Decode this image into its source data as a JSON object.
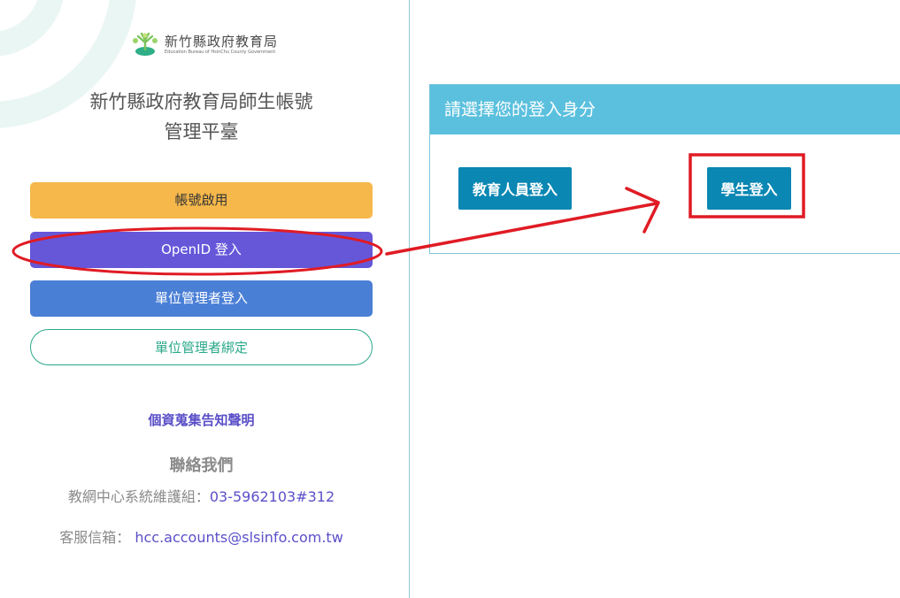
{
  "logo": {
    "text": "新竹縣政府教育局",
    "subtitle": "Education Bureau of HsinChu County Government"
  },
  "sidebar": {
    "title_line1": "新竹縣政府教育局師生帳號",
    "title_line2": "管理平臺",
    "buttons": {
      "activate": "帳號啟用",
      "openid": "OpenID 登入",
      "admin_login": "單位管理者登入",
      "admin_bind": "單位管理者綁定"
    },
    "privacy_link": "個資蒐集告知聲明",
    "contact": {
      "title": "聯絡我們",
      "phone_label": "教網中心系統維護組：",
      "phone": "03-5962103#312",
      "email_label": "客服信箱：",
      "email": "hcc.accounts@slsinfo.com.tw"
    }
  },
  "panel": {
    "header": "請選擇您的登入身分",
    "staff_button": "教育人員登入",
    "student_button": "學生登入"
  },
  "colors": {
    "activate": "#f6b84b",
    "openid": "#6657d9",
    "admin": "#4a7fd6",
    "bind": "#2aa889",
    "panel_header": "#5bc0de",
    "role_button": "#0a87b3",
    "annotation": "#e01b24"
  }
}
